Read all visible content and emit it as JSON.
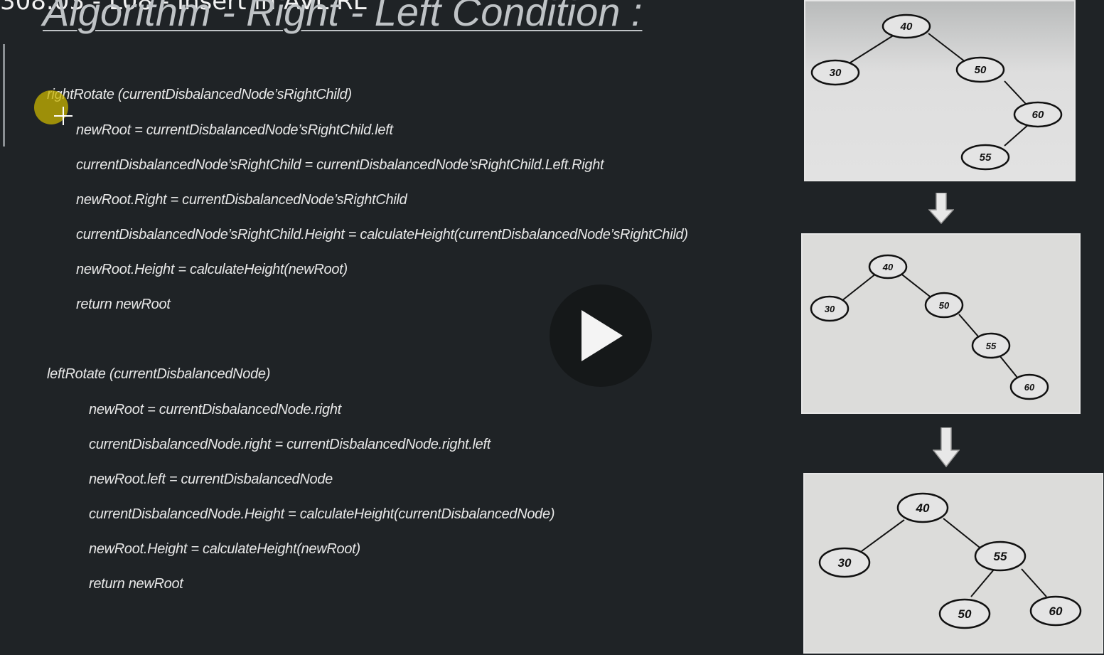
{
  "overlay": {
    "title": "308.03 - L08 - Insert in AVL RL"
  },
  "slide": {
    "title": "Algorithm - Right - Left Condition :",
    "right_rotate": {
      "signature": "rightRotate (currentDisbalancedNode’sRightChild)",
      "lines": [
        "newRoot = currentDisbalancedNode’sRightChild.left",
        "currentDisbalancedNode’sRightChild = currentDisbalancedNode’sRightChild.Left.Right",
        "newRoot.Right = currentDisbalancedNode’sRightChild",
        "currentDisbalancedNode’sRightChild.Height = calculateHeight(currentDisbalancedNode’sRightChild)",
        "newRoot.Height = calculateHeight(newRoot)",
        "return newRoot"
      ]
    },
    "left_rotate": {
      "signature": "leftRotate (currentDisbalancedNode)",
      "lines": [
        "newRoot = currentDisbalancedNode.right",
        "currentDisbalancedNode.right = currentDisbalancedNode.right.left",
        "newRoot.left = currentDisbalancedNode",
        "currentDisbalancedNode.Height = calculateHeight(currentDisbalancedNode)",
        "newRoot.Height = calculateHeight(newRoot)",
        "return newRoot"
      ]
    },
    "trees": [
      {
        "nodes": [
          "40",
          "30",
          "50",
          "60",
          "55"
        ]
      },
      {
        "nodes": [
          "40",
          "30",
          "50",
          "55",
          "60"
        ]
      },
      {
        "nodes": [
          "40",
          "30",
          "55",
          "50",
          "60"
        ]
      }
    ]
  },
  "player": {
    "play_icon": "play-icon"
  },
  "colors": {
    "background": "#1f2326",
    "code_text": "#e8e8e8",
    "panel": "#dcdcda",
    "cursor": "#c8b400"
  }
}
